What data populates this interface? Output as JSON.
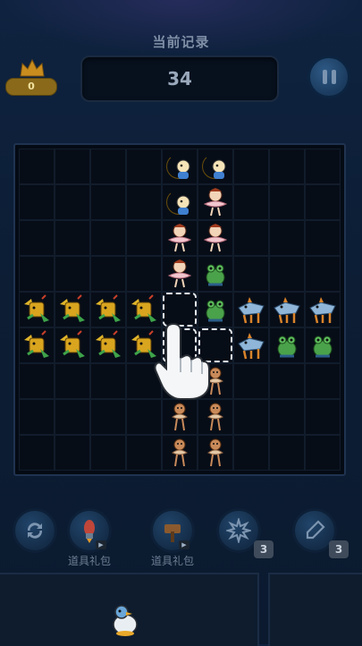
{
  "header": {
    "record_title": "当前记录",
    "score": "34",
    "crown_count": "0"
  },
  "board": {
    "rows": 9,
    "cols": 9,
    "pieces": [
      {
        "row": 0,
        "col": 4,
        "kind": "moon-duck"
      },
      {
        "row": 0,
        "col": 5,
        "kind": "moon-duck"
      },
      {
        "row": 1,
        "col": 4,
        "kind": "moon-duck"
      },
      {
        "row": 1,
        "col": 5,
        "kind": "ballerina"
      },
      {
        "row": 2,
        "col": 4,
        "kind": "ballerina"
      },
      {
        "row": 2,
        "col": 5,
        "kind": "ballerina"
      },
      {
        "row": 3,
        "col": 4,
        "kind": "ballerina"
      },
      {
        "row": 3,
        "col": 5,
        "kind": "green-frog"
      },
      {
        "row": 4,
        "col": 0,
        "kind": "dragon-warrior"
      },
      {
        "row": 4,
        "col": 1,
        "kind": "dragon-warrior"
      },
      {
        "row": 4,
        "col": 2,
        "kind": "dragon-warrior"
      },
      {
        "row": 4,
        "col": 3,
        "kind": "dragon-warrior"
      },
      {
        "row": 4,
        "col": 5,
        "kind": "green-frog"
      },
      {
        "row": 4,
        "col": 6,
        "kind": "shark-cat"
      },
      {
        "row": 4,
        "col": 7,
        "kind": "shark-cat"
      },
      {
        "row": 4,
        "col": 8,
        "kind": "shark-cat"
      },
      {
        "row": 5,
        "col": 0,
        "kind": "dragon-warrior"
      },
      {
        "row": 5,
        "col": 1,
        "kind": "dragon-warrior"
      },
      {
        "row": 5,
        "col": 2,
        "kind": "dragon-warrior"
      },
      {
        "row": 5,
        "col": 3,
        "kind": "dragon-warrior"
      },
      {
        "row": 5,
        "col": 6,
        "kind": "shark-cat"
      },
      {
        "row": 5,
        "col": 7,
        "kind": "green-frog"
      },
      {
        "row": 5,
        "col": 8,
        "kind": "green-frog"
      },
      {
        "row": 6,
        "col": 5,
        "kind": "monkey-dancer"
      },
      {
        "row": 7,
        "col": 4,
        "kind": "monkey-dancer"
      },
      {
        "row": 7,
        "col": 5,
        "kind": "monkey-dancer"
      },
      {
        "row": 8,
        "col": 4,
        "kind": "monkey-dancer"
      },
      {
        "row": 8,
        "col": 5,
        "kind": "monkey-dancer"
      }
    ],
    "hint_cells": [
      {
        "row": 4,
        "col": 4
      },
      {
        "row": 5,
        "col": 4
      },
      {
        "row": 5,
        "col": 5
      }
    ]
  },
  "tools": [
    {
      "name": "refresh-icon",
      "label": "",
      "count": ""
    },
    {
      "name": "rocket-icon",
      "label": "道具礼包",
      "count": ""
    },
    {
      "name": "hammer-icon",
      "label": "道具礼包",
      "count": ""
    },
    {
      "name": "bomb-icon",
      "label": "",
      "count": "3"
    },
    {
      "name": "brush-icon",
      "label": "",
      "count": "3"
    }
  ],
  "next_piece": {
    "kind": "penguin-duck"
  },
  "colors": {
    "accent": "#2e5a86",
    "board_bg": "#050b14",
    "crown": "#e3a92a"
  }
}
